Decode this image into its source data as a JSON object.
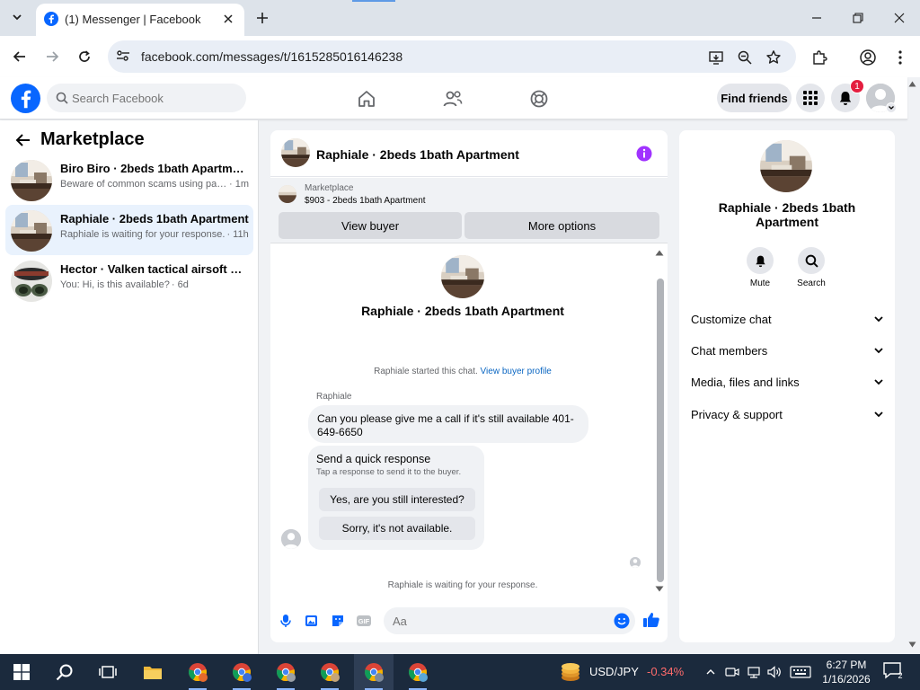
{
  "browser": {
    "tab_title": "(1) Messenger | Facebook",
    "url": "facebook.com/messages/t/1615285016146238"
  },
  "facebook": {
    "search_placeholder": "Search Facebook",
    "find_friends": "Find friends",
    "notification_count": "1"
  },
  "sidebar": {
    "title": "Marketplace",
    "conversations": [
      {
        "name": "Biro Biro · 2beds 1bath Apartment",
        "message": "Beware of common scams using pay...",
        "time": " · 1m",
        "active": false
      },
      {
        "name": "Raphiale · 2beds 1bath Apartment",
        "message": "Raphiale is waiting for your response.",
        "time": " · 11h",
        "active": true
      },
      {
        "name": "Hector · Valken tactical airsoft gog...",
        "message": "You: Hi, is this available?",
        "time": " · 6d",
        "active": false
      }
    ]
  },
  "chat": {
    "title": "Raphiale · 2beds 1bath Apartment",
    "listing_label": "Marketplace",
    "listing_title": "$903 - 2beds 1bath Apartment",
    "view_buyer": "View buyer",
    "more_options": "More options",
    "started_text": "Raphiale started this chat.",
    "view_buyer_profile": "View buyer profile",
    "sender_name": "Raphiale",
    "message": "Can you please give me a call if it's still available 401-649-6650",
    "quick_title": "Send a quick response",
    "quick_sub": "Tap a response to send it to the buyer.",
    "quick_options": [
      "Yes, are you still interested?",
      "Sorry, it's not available."
    ],
    "waiting": "Raphiale is waiting for your response.",
    "input_placeholder": "Aa"
  },
  "info": {
    "title": "Raphiale · 2beds 1bath Apartment",
    "actions": [
      "Mute",
      "Search"
    ],
    "rows": [
      "Customize chat",
      "Chat members",
      "Media, files and links",
      "Privacy & support"
    ]
  },
  "taskbar": {
    "ticker_name": "USD/JPY",
    "ticker_change": "-0.34%",
    "time": "6:27 PM",
    "date": "1/16/2026",
    "notification_count": "2"
  },
  "colors": {
    "facebook_blue": "#0866ff",
    "messenger_purple": "#a033ff",
    "badge_red": "#e41e3f",
    "active_conversation": "#e9f2fd"
  }
}
